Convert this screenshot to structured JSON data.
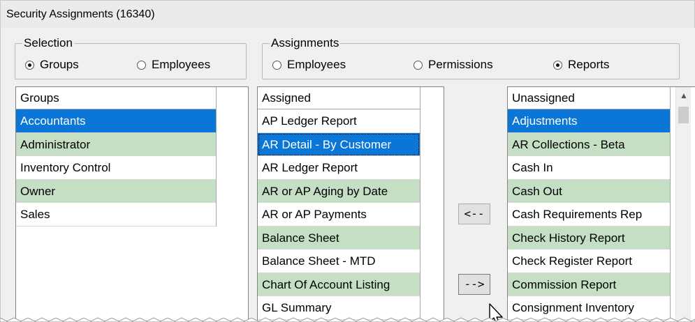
{
  "window": {
    "title": "Security Assignments (16340)"
  },
  "selection": {
    "legend": "Selection",
    "options": [
      {
        "label": "Groups",
        "checked": true
      },
      {
        "label": "Employees",
        "checked": false
      }
    ]
  },
  "assignments": {
    "legend": "Assignments",
    "options": [
      {
        "label": "Employees",
        "checked": false
      },
      {
        "label": "Permissions",
        "checked": false
      },
      {
        "label": "Reports",
        "checked": true
      }
    ]
  },
  "groups_list": {
    "header": "Groups",
    "items": [
      "Accountants",
      "Administrator",
      "Inventory Control",
      "Owner",
      "Sales"
    ]
  },
  "assigned_list": {
    "header": "Assigned",
    "items": [
      "AP Ledger Report",
      "AR Detail - By Customer",
      "AR Ledger Report",
      "AR or AP Aging by Date",
      "AR or AP Payments",
      "Balance Sheet",
      "Balance Sheet - MTD",
      "Chart Of Account Listing",
      "GL Summary"
    ]
  },
  "unassigned_list": {
    "header": "Unassigned",
    "items": [
      "Adjustments",
      "AR Collections - Beta",
      "Cash In",
      "Cash Out",
      "Cash Requirements Rep",
      "Check History Report",
      "Check Register Report",
      "Commission Report",
      "Consignment Inventory"
    ]
  },
  "buttons": {
    "unassign": "<--",
    "assign": "-->"
  },
  "colors": {
    "selection": "#0a76d8",
    "alt_row": "#c4dfc4"
  }
}
